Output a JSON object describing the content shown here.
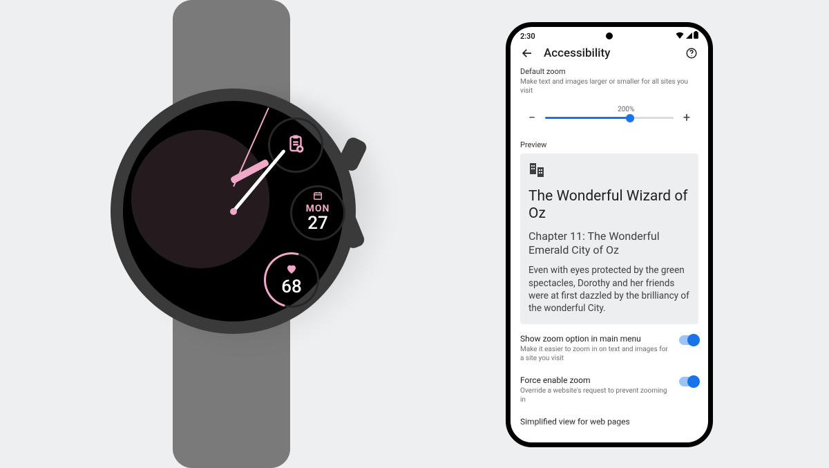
{
  "watch": {
    "day_label": "MON",
    "date": "27",
    "heart_rate": "68"
  },
  "phone": {
    "status_time": "2:30",
    "appbar_title": "Accessibility",
    "zoom": {
      "label": "Default zoom",
      "caption": "Make text and images larger or smaller for all sites you visit",
      "value_label": "200%"
    },
    "preview": {
      "label": "Preview",
      "title": "The Wonderful Wizard of Oz",
      "subtitle": "Chapter 11: The Wonderful Emerald City of Oz",
      "body": "Even with eyes protected by the green spectacles, Dorothy and her friends were at first dazzled by the brilliancy of the wonderful City."
    },
    "settings": {
      "show_zoom": {
        "name": "Show zoom option in main menu",
        "caption": "Make it easier to zoom in on text and images for a site you visit"
      },
      "force_zoom": {
        "name": "Force enable zoom",
        "caption": "Override a website's request to prevent zooming in"
      },
      "simplified": {
        "name": "Simplified view for web pages"
      }
    }
  }
}
